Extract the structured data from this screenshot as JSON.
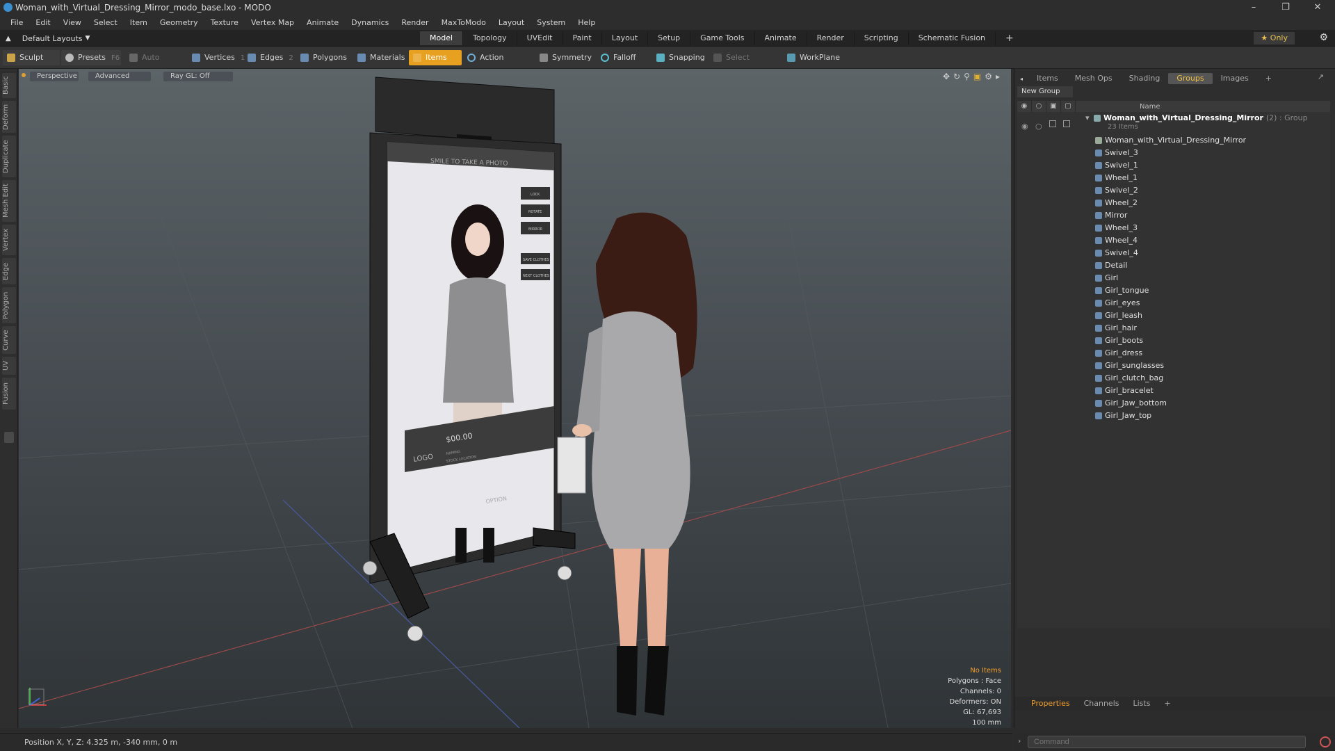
{
  "window": {
    "title": "Woman_with_Virtual_Dressing_Mirror_modo_base.lxo - MODO"
  },
  "menu": [
    "File",
    "Edit",
    "View",
    "Select",
    "Item",
    "Geometry",
    "Texture",
    "Vertex Map",
    "Animate",
    "Dynamics",
    "Render",
    "MaxToModo",
    "Layout",
    "System",
    "Help"
  ],
  "layouts": {
    "label": "Default Layouts"
  },
  "mode_tabs": [
    {
      "label": "Model",
      "active": true
    },
    {
      "label": "Topology"
    },
    {
      "label": "UVEdit"
    },
    {
      "label": "Paint"
    },
    {
      "label": "Layout"
    },
    {
      "label": "Setup"
    },
    {
      "label": "Game Tools"
    },
    {
      "label": "Animate"
    },
    {
      "label": "Render"
    },
    {
      "label": "Scripting"
    },
    {
      "label": "Schematic Fusion"
    }
  ],
  "only_label": "Only",
  "toolbar": {
    "sculpt": "Sculpt",
    "presets": "Presets",
    "presets_key": "F6",
    "auto_select": "Auto Select",
    "vertices": "Vertices",
    "vertices_count": "1",
    "edges": "Edges",
    "edges_count": "2",
    "polygons": "Polygons",
    "materials": "Materials",
    "items": "Items",
    "action_center": "Action Center",
    "symmetry": "Symmetry",
    "falloff": "Falloff",
    "snapping": "Snapping",
    "select_through": "Select Through",
    "workplane": "WorkPlane"
  },
  "left_tabs": [
    "Basic",
    "Deform",
    "Duplicate",
    "Mesh Edit",
    "Vertex",
    "Edge",
    "Polygon",
    "Curve",
    "UV",
    "Fusion"
  ],
  "viewport": {
    "view": "Perspective",
    "shading": "Advanced",
    "raygl": "Ray GL: Off",
    "mirror_screen": {
      "header": "SMILE TO TAKE A PHOTO",
      "buttons": [
        "LOCK",
        "ROTATE",
        "MIRROR",
        "SAVE CLOTHES",
        "NEXT CLOTHES"
      ],
      "price": "$00.00",
      "logo": "LOGO",
      "naming": "NAMING",
      "stock": "STOCK LOCATION",
      "option": "OPTION"
    },
    "stats": {
      "no_items": "No Items",
      "polygons": "Polygons : Face",
      "channels": "Channels: 0",
      "deformers": "Deformers: ON",
      "gl": "GL: 67,693",
      "scale": "100 mm"
    }
  },
  "right_panel": {
    "tabs": [
      {
        "label": "Items"
      },
      {
        "label": "Mesh Ops"
      },
      {
        "label": "Shading"
      },
      {
        "label": "Groups",
        "active": true
      },
      {
        "label": "Images"
      }
    ],
    "new_group": "New Group",
    "column_name": "Name",
    "group": {
      "name": "Woman_with_Virtual_Dressing_Mirror",
      "suffix": "(2) : Group",
      "count": "23 Items"
    },
    "items": [
      "Woman_with_Virtual_Dressing_Mirror",
      "Swivel_3",
      "Swivel_1",
      "Wheel_1",
      "Swivel_2",
      "Wheel_2",
      "Mirror",
      "Wheel_3",
      "Wheel_4",
      "Swivel_4",
      "Detail",
      "Girl",
      "Girl_tongue",
      "Girl_eyes",
      "Girl_leash",
      "Girl_hair",
      "Girl_boots",
      "Girl_dress",
      "Girl_sunglasses",
      "Girl_clutch_bag",
      "Girl_bracelet",
      "Girl_Jaw_bottom",
      "Girl_Jaw_top"
    ],
    "bottom_tabs": [
      {
        "label": "Properties",
        "active": true
      },
      {
        "label": "Channels"
      },
      {
        "label": "Lists"
      }
    ]
  },
  "statusbar": {
    "position": "Position X, Y, Z:  4.325 m, -340 mm, 0 m"
  },
  "command": {
    "placeholder": "Command"
  },
  "colors": {
    "accent": "#f0a030",
    "items_active": "#e8a020",
    "selected_tab": "#f0c040"
  }
}
